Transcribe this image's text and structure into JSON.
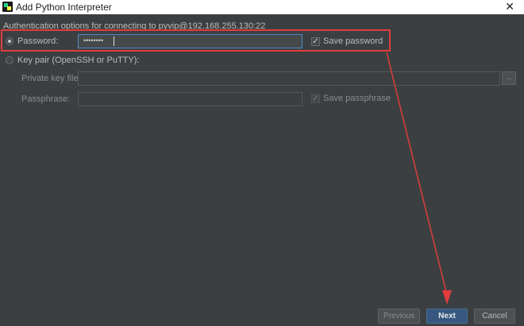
{
  "window": {
    "title": "Add Python Interpreter",
    "close_glyph": "✕"
  },
  "auth": {
    "description": "Authentication options for connecting to pyvip@192.168.255.130:22"
  },
  "password_option": {
    "label": "Password:",
    "selected": true,
    "value_masked": "••••••••",
    "save_label": "Save password",
    "save_checked": true
  },
  "keypair_option": {
    "label": "Key pair (OpenSSH or PuTTY):",
    "selected": false,
    "private_key_label": "Private key file:",
    "private_key_value": "",
    "browse_label": "...",
    "passphrase_label": "Passphrase:",
    "passphrase_value": "",
    "save_passphrase_label": "Save passphrase",
    "save_passphrase_checked": true
  },
  "footer": {
    "previous_label": "Previous",
    "next_label": "Next",
    "cancel_label": "Cancel"
  },
  "colors": {
    "background": "#3c3f41",
    "accent": "#365880",
    "annotation": "#e03c3c"
  },
  "icons": {
    "app": "pycharm-icon",
    "close": "close-icon",
    "check": "check-icon"
  }
}
